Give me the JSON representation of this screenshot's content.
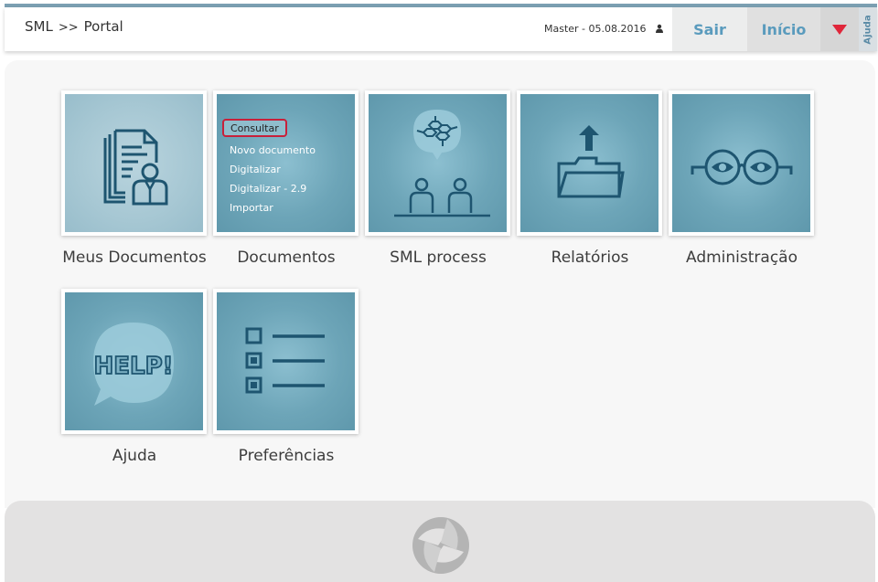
{
  "header": {
    "breadcrumb": [
      "SML",
      ">>",
      "Portal"
    ],
    "user_info": "Master - 05.08.2016",
    "sair_label": "Sair",
    "inicio_label": "Início",
    "ajuda_tab_label": "Ajuda"
  },
  "colors": {
    "accent": "#5a9bbd",
    "menu_arrow": "#e0263a",
    "tile_blue": "#6da5b8",
    "icon_dark": "#1e5570"
  },
  "tiles": [
    {
      "label": "Meus Documentos",
      "icon": "documents-person-icon"
    },
    {
      "label": "Documentos",
      "icon": "menu",
      "menu": [
        "Consultar",
        "Novo documento",
        "Digitalizar",
        "Digitalizar - 2.9",
        "Importar"
      ],
      "selected_menu_item": "Consultar"
    },
    {
      "label": "SML process",
      "icon": "process-network-icon"
    },
    {
      "label": "Relatórios",
      "icon": "folder-upload-icon"
    },
    {
      "label": "Administração",
      "icon": "glasses-icon"
    },
    {
      "label": "Ajuda",
      "icon": "help-bubble-icon",
      "icon_text": "HELP!"
    },
    {
      "label": "Preferências",
      "icon": "checklist-icon"
    }
  ]
}
